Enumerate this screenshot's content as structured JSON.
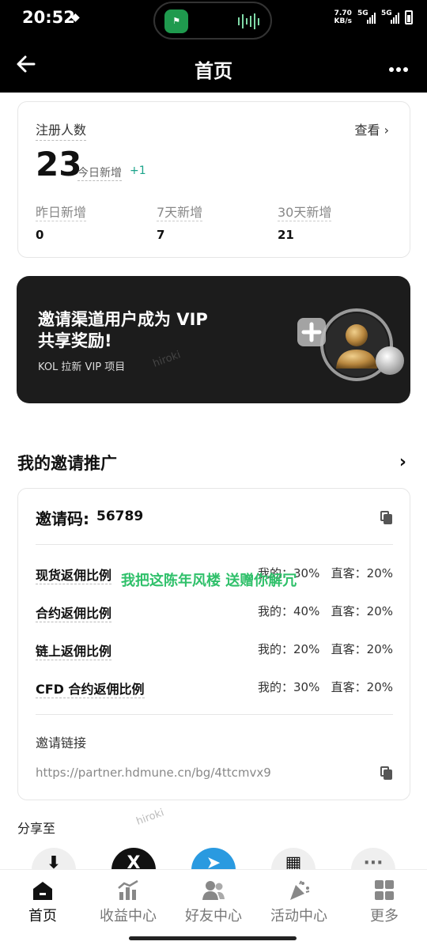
{
  "status": {
    "time": "20:52",
    "net_speed": "7.70",
    "net_unit": "KB/s",
    "sig1": "5G",
    "sig2": "5G"
  },
  "header": {
    "title": "首页",
    "back_icon": "arrow-left-icon",
    "more_icon": "more-icon"
  },
  "registrations": {
    "label": "注册人数",
    "view_label": "查看",
    "count": "23",
    "today_label": "今日新增",
    "today_value": "+1",
    "stats": [
      {
        "label": "昨日新增",
        "value": "0"
      },
      {
        "label": "7天新增",
        "value": "7"
      },
      {
        "label": "30天新增",
        "value": "21"
      }
    ]
  },
  "banner": {
    "title_line1": "邀请渠道用户成为 VIP",
    "title_line2": "共享奖励!",
    "subtitle": "KOL 拉新 VIP 项目",
    "watermark": "hiroki"
  },
  "invite": {
    "section_title": "我的邀请推广",
    "code_label": "邀请码:",
    "code_value": "56789",
    "rates": [
      {
        "name": "现货返佣比例",
        "values": "我的：30%   直客：20%"
      },
      {
        "name": "合约返佣比例",
        "values": "我的：40%   直客：20%"
      },
      {
        "name": "链上返佣比例",
        "values": "我的：20%   直客：20%"
      },
      {
        "name": "CFD 合约返佣比例",
        "values": "我的：30%   直客：20%"
      }
    ],
    "overlay_text": "我把这陈年风楼 送赠你解冗",
    "link_label": "邀请链接",
    "link_value": "https://partner.hdmune.cn/bg/4ttcmvx9"
  },
  "share": {
    "label": "分享至",
    "watermark": "hiroki",
    "icons": [
      "download-icon",
      "x-icon",
      "telegram-icon",
      "qr-code-icon",
      "more-share-icon"
    ]
  },
  "nav": {
    "items": [
      {
        "label": "首页",
        "icon": "home-icon"
      },
      {
        "label": "收益中心",
        "icon": "chart-icon"
      },
      {
        "label": "好友中心",
        "icon": "friends-icon"
      },
      {
        "label": "活动中心",
        "icon": "party-icon"
      },
      {
        "label": "更多",
        "icon": "grid-icon"
      }
    ]
  },
  "colors": {
    "accent_green": "#1aa38a",
    "banner_bg": "#1c1c1c",
    "header_bg": "#000000",
    "overlay_text": "#2fc06a"
  }
}
